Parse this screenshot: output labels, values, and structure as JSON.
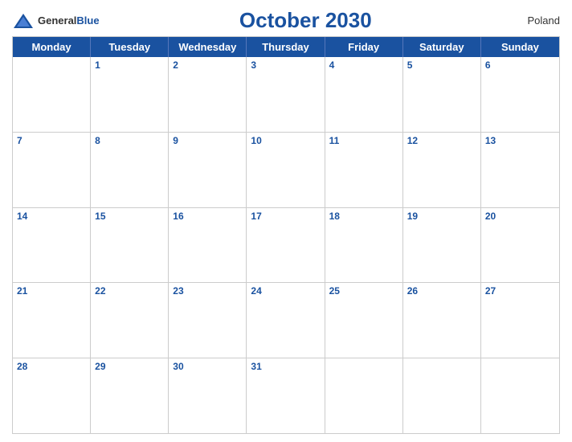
{
  "header": {
    "logo_general": "General",
    "logo_blue": "Blue",
    "title": "October 2030",
    "country": "Poland"
  },
  "days_of_week": [
    "Monday",
    "Tuesday",
    "Wednesday",
    "Thursday",
    "Friday",
    "Saturday",
    "Sunday"
  ],
  "weeks": [
    [
      {
        "date": "",
        "empty": true
      },
      {
        "date": "1"
      },
      {
        "date": "2"
      },
      {
        "date": "3"
      },
      {
        "date": "4"
      },
      {
        "date": "5"
      },
      {
        "date": "6"
      }
    ],
    [
      {
        "date": "7"
      },
      {
        "date": "8"
      },
      {
        "date": "9"
      },
      {
        "date": "10"
      },
      {
        "date": "11"
      },
      {
        "date": "12"
      },
      {
        "date": "13"
      }
    ],
    [
      {
        "date": "14"
      },
      {
        "date": "15"
      },
      {
        "date": "16"
      },
      {
        "date": "17"
      },
      {
        "date": "18"
      },
      {
        "date": "19"
      },
      {
        "date": "20"
      }
    ],
    [
      {
        "date": "21"
      },
      {
        "date": "22"
      },
      {
        "date": "23"
      },
      {
        "date": "24"
      },
      {
        "date": "25"
      },
      {
        "date": "26"
      },
      {
        "date": "27"
      }
    ],
    [
      {
        "date": "28"
      },
      {
        "date": "29"
      },
      {
        "date": "30"
      },
      {
        "date": "31"
      },
      {
        "date": "",
        "empty": true
      },
      {
        "date": "",
        "empty": true
      },
      {
        "date": "",
        "empty": true
      }
    ]
  ]
}
